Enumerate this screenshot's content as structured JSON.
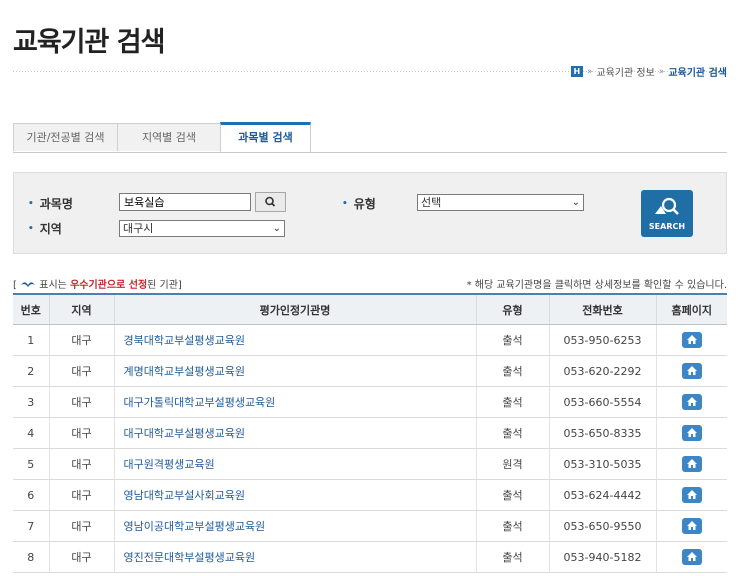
{
  "page": {
    "title": "교육기관 검색"
  },
  "breadcrumb": {
    "home": "H",
    "items": [
      "교육기관 정보"
    ],
    "current": "교육기관 검색"
  },
  "tabs": [
    {
      "label": "기관/전공별 검색",
      "active": false
    },
    {
      "label": "지역별 검색",
      "active": false
    },
    {
      "label": "과목별 검색",
      "active": true
    }
  ],
  "search": {
    "subject_label": "과목명",
    "subject_value": "보육실습",
    "region_label": "지역",
    "region_value": "대구시",
    "type_label": "유형",
    "type_value": "선택",
    "button_label": "SEARCH"
  },
  "legend": {
    "prefix": "[",
    "text1": " 표시는 ",
    "highlight": "우수기관으로 선정",
    "text2": "된 기관]"
  },
  "note": "* 해당 교육기관명을 클릭하면 상세정보를 확인할 수 있습니다.",
  "table": {
    "headers": [
      "번호",
      "지역",
      "평가인정기관명",
      "유형",
      "전화번호",
      "홈페이지"
    ],
    "rows": [
      {
        "no": "1",
        "region": "대구",
        "name": "경북대학교부설평생교육원",
        "type": "출석",
        "phone": "053-950-6253"
      },
      {
        "no": "2",
        "region": "대구",
        "name": "계명대학교부설평생교육원",
        "type": "출석",
        "phone": "053-620-2292"
      },
      {
        "no": "3",
        "region": "대구",
        "name": "대구가톨릭대학교부설평생교육원",
        "type": "출석",
        "phone": "053-660-5554"
      },
      {
        "no": "4",
        "region": "대구",
        "name": "대구대학교부설평생교육원",
        "type": "출석",
        "phone": "053-650-8335"
      },
      {
        "no": "5",
        "region": "대구",
        "name": "대구원격평생교육원",
        "type": "원격",
        "phone": "053-310-5035"
      },
      {
        "no": "6",
        "region": "대구",
        "name": "영남대학교부설사회교육원",
        "type": "출석",
        "phone": "053-624-4442"
      },
      {
        "no": "7",
        "region": "대구",
        "name": "영남이공대학교부설평생교육원",
        "type": "출석",
        "phone": "053-650-9550"
      },
      {
        "no": "8",
        "region": "대구",
        "name": "영진전문대학부설평생교육원",
        "type": "출석",
        "phone": "053-940-5182"
      }
    ]
  },
  "colors": {
    "accent": "#1f6fb2",
    "highlight": "#c7252d",
    "link": "#1f5b99"
  }
}
